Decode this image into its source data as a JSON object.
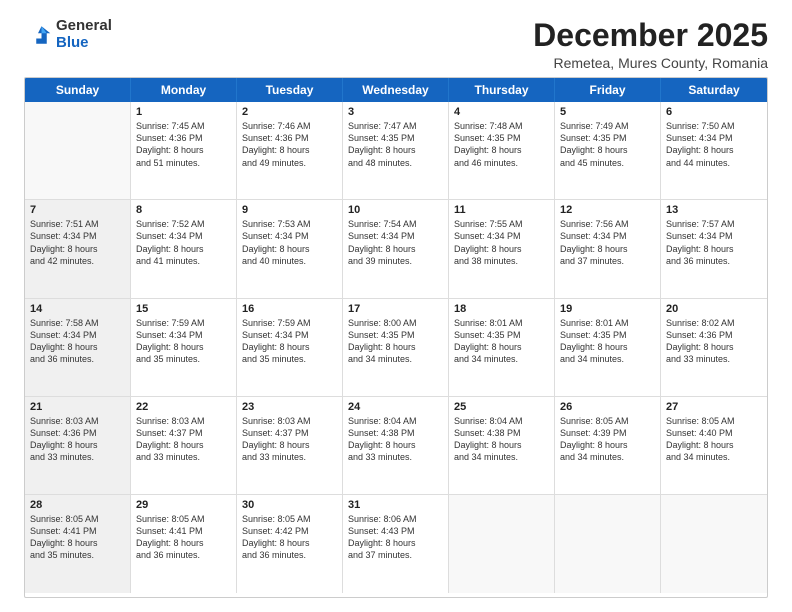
{
  "logo": {
    "general": "General",
    "blue": "Blue"
  },
  "title": "December 2025",
  "subtitle": "Remetea, Mures County, Romania",
  "header_days": [
    "Sunday",
    "Monday",
    "Tuesday",
    "Wednesday",
    "Thursday",
    "Friday",
    "Saturday"
  ],
  "weeks": [
    [
      {
        "day": "",
        "empty": true,
        "text": ""
      },
      {
        "day": "1",
        "text": "Sunrise: 7:45 AM\nSunset: 4:36 PM\nDaylight: 8 hours\nand 51 minutes."
      },
      {
        "day": "2",
        "text": "Sunrise: 7:46 AM\nSunset: 4:36 PM\nDaylight: 8 hours\nand 49 minutes."
      },
      {
        "day": "3",
        "text": "Sunrise: 7:47 AM\nSunset: 4:35 PM\nDaylight: 8 hours\nand 48 minutes."
      },
      {
        "day": "4",
        "text": "Sunrise: 7:48 AM\nSunset: 4:35 PM\nDaylight: 8 hours\nand 46 minutes."
      },
      {
        "day": "5",
        "text": "Sunrise: 7:49 AM\nSunset: 4:35 PM\nDaylight: 8 hours\nand 45 minutes."
      },
      {
        "day": "6",
        "text": "Sunrise: 7:50 AM\nSunset: 4:34 PM\nDaylight: 8 hours\nand 44 minutes."
      }
    ],
    [
      {
        "day": "7",
        "shaded": true,
        "text": "Sunrise: 7:51 AM\nSunset: 4:34 PM\nDaylight: 8 hours\nand 42 minutes."
      },
      {
        "day": "8",
        "text": "Sunrise: 7:52 AM\nSunset: 4:34 PM\nDaylight: 8 hours\nand 41 minutes."
      },
      {
        "day": "9",
        "text": "Sunrise: 7:53 AM\nSunset: 4:34 PM\nDaylight: 8 hours\nand 40 minutes."
      },
      {
        "day": "10",
        "text": "Sunrise: 7:54 AM\nSunset: 4:34 PM\nDaylight: 8 hours\nand 39 minutes."
      },
      {
        "day": "11",
        "text": "Sunrise: 7:55 AM\nSunset: 4:34 PM\nDaylight: 8 hours\nand 38 minutes."
      },
      {
        "day": "12",
        "text": "Sunrise: 7:56 AM\nSunset: 4:34 PM\nDaylight: 8 hours\nand 37 minutes."
      },
      {
        "day": "13",
        "text": "Sunrise: 7:57 AM\nSunset: 4:34 PM\nDaylight: 8 hours\nand 36 minutes."
      }
    ],
    [
      {
        "day": "14",
        "shaded": true,
        "text": "Sunrise: 7:58 AM\nSunset: 4:34 PM\nDaylight: 8 hours\nand 36 minutes."
      },
      {
        "day": "15",
        "text": "Sunrise: 7:59 AM\nSunset: 4:34 PM\nDaylight: 8 hours\nand 35 minutes."
      },
      {
        "day": "16",
        "text": "Sunrise: 7:59 AM\nSunset: 4:34 PM\nDaylight: 8 hours\nand 35 minutes."
      },
      {
        "day": "17",
        "text": "Sunrise: 8:00 AM\nSunset: 4:35 PM\nDaylight: 8 hours\nand 34 minutes."
      },
      {
        "day": "18",
        "text": "Sunrise: 8:01 AM\nSunset: 4:35 PM\nDaylight: 8 hours\nand 34 minutes."
      },
      {
        "day": "19",
        "text": "Sunrise: 8:01 AM\nSunset: 4:35 PM\nDaylight: 8 hours\nand 34 minutes."
      },
      {
        "day": "20",
        "text": "Sunrise: 8:02 AM\nSunset: 4:36 PM\nDaylight: 8 hours\nand 33 minutes."
      }
    ],
    [
      {
        "day": "21",
        "shaded": true,
        "text": "Sunrise: 8:03 AM\nSunset: 4:36 PM\nDaylight: 8 hours\nand 33 minutes."
      },
      {
        "day": "22",
        "text": "Sunrise: 8:03 AM\nSunset: 4:37 PM\nDaylight: 8 hours\nand 33 minutes."
      },
      {
        "day": "23",
        "text": "Sunrise: 8:03 AM\nSunset: 4:37 PM\nDaylight: 8 hours\nand 33 minutes."
      },
      {
        "day": "24",
        "text": "Sunrise: 8:04 AM\nSunset: 4:38 PM\nDaylight: 8 hours\nand 33 minutes."
      },
      {
        "day": "25",
        "text": "Sunrise: 8:04 AM\nSunset: 4:38 PM\nDaylight: 8 hours\nand 34 minutes."
      },
      {
        "day": "26",
        "text": "Sunrise: 8:05 AM\nSunset: 4:39 PM\nDaylight: 8 hours\nand 34 minutes."
      },
      {
        "day": "27",
        "text": "Sunrise: 8:05 AM\nSunset: 4:40 PM\nDaylight: 8 hours\nand 34 minutes."
      }
    ],
    [
      {
        "day": "28",
        "shaded": true,
        "text": "Sunrise: 8:05 AM\nSunset: 4:41 PM\nDaylight: 8 hours\nand 35 minutes."
      },
      {
        "day": "29",
        "text": "Sunrise: 8:05 AM\nSunset: 4:41 PM\nDaylight: 8 hours\nand 36 minutes."
      },
      {
        "day": "30",
        "text": "Sunrise: 8:05 AM\nSunset: 4:42 PM\nDaylight: 8 hours\nand 36 minutes."
      },
      {
        "day": "31",
        "text": "Sunrise: 8:06 AM\nSunset: 4:43 PM\nDaylight: 8 hours\nand 37 minutes."
      },
      {
        "day": "",
        "empty": true,
        "text": ""
      },
      {
        "day": "",
        "empty": true,
        "text": ""
      },
      {
        "day": "",
        "empty": true,
        "text": ""
      }
    ]
  ]
}
